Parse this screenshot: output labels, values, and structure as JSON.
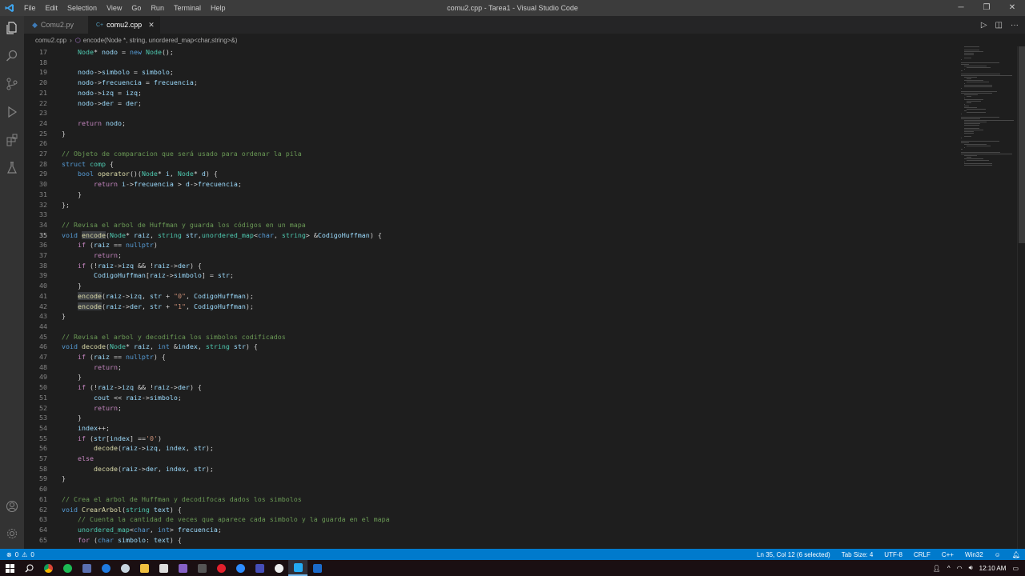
{
  "window": {
    "title": "comu2.cpp - Tarea1 - Visual Studio Code",
    "menu": [
      "File",
      "Edit",
      "Selection",
      "View",
      "Go",
      "Run",
      "Terminal",
      "Help"
    ]
  },
  "tabs": [
    {
      "label": "Comu2.py",
      "active": false
    },
    {
      "label": "comu2.cpp",
      "active": true
    }
  ],
  "breadcrumb": {
    "file": "comu2.cpp",
    "symbol": "encode(Node *, string, unordered_map<char,string>&)"
  },
  "editor": {
    "lines": [
      {
        "n": "17",
        "t": "    Node* nodo = new Node();"
      },
      {
        "n": "18",
        "t": ""
      },
      {
        "n": "19",
        "t": "    nodo->simbolo = simbolo;"
      },
      {
        "n": "20",
        "t": "    nodo->frecuencia = frecuencia;"
      },
      {
        "n": "21",
        "t": "    nodo->izq = izq;"
      },
      {
        "n": "22",
        "t": "    nodo->der = der;"
      },
      {
        "n": "23",
        "t": ""
      },
      {
        "n": "24",
        "t": "    return nodo;"
      },
      {
        "n": "25",
        "t": "}"
      },
      {
        "n": "26",
        "t": ""
      },
      {
        "n": "27",
        "t": "// Objeto de comparacion que será usado para ordenar la pila"
      },
      {
        "n": "28",
        "t": "struct comp {"
      },
      {
        "n": "29",
        "t": "    bool operator()(Node* i, Node* d) {"
      },
      {
        "n": "30",
        "t": "        return i->frecuencia > d->frecuencia;"
      },
      {
        "n": "31",
        "t": "    }"
      },
      {
        "n": "32",
        "t": "};"
      },
      {
        "n": "33",
        "t": ""
      },
      {
        "n": "34",
        "t": "// Revisa el arbol de Huffman y guarda los códigos en un mapa"
      },
      {
        "n": "35",
        "t": "void encode(Node* raiz, string str,unordered_map<char, string> &CodigoHuffman) {"
      },
      {
        "n": "36",
        "t": "    if (raiz == nullptr)"
      },
      {
        "n": "37",
        "t": "        return;"
      },
      {
        "n": "38",
        "t": "    if (!raiz->izq && !raiz->der) {"
      },
      {
        "n": "39",
        "t": "        CodigoHuffman[raiz->simbolo] = str;"
      },
      {
        "n": "40",
        "t": "    }"
      },
      {
        "n": "41",
        "t": "    encode(raiz->izq, str + \"0\", CodigoHuffman);"
      },
      {
        "n": "42",
        "t": "    encode(raiz->der, str + \"1\", CodigoHuffman);"
      },
      {
        "n": "43",
        "t": "}"
      },
      {
        "n": "44",
        "t": ""
      },
      {
        "n": "45",
        "t": "// Revisa el arbol y decodifica los simbolos codificados"
      },
      {
        "n": "46",
        "t": "void decode(Node* raiz, int &index, string str) {"
      },
      {
        "n": "47",
        "t": "    if (raiz == nullptr) {"
      },
      {
        "n": "48",
        "t": "        return;"
      },
      {
        "n": "49",
        "t": "    }"
      },
      {
        "n": "50",
        "t": "    if (!raiz->izq && !raiz->der) {"
      },
      {
        "n": "51",
        "t": "        cout << raiz->simbolo;"
      },
      {
        "n": "52",
        "t": "        return;"
      },
      {
        "n": "53",
        "t": "    }"
      },
      {
        "n": "54",
        "t": "    index++;"
      },
      {
        "n": "55",
        "t": "    if (str[index] =='0')"
      },
      {
        "n": "56",
        "t": "        decode(raiz->izq, index, str);"
      },
      {
        "n": "57",
        "t": "    else"
      },
      {
        "n": "58",
        "t": "        decode(raiz->der, index, str);"
      },
      {
        "n": "59",
        "t": "}"
      },
      {
        "n": "60",
        "t": ""
      },
      {
        "n": "61",
        "t": "// Crea el arbol de Huffman y decodifocas dados los simbolos"
      },
      {
        "n": "62",
        "t": "void CrearArbol(string text) {"
      },
      {
        "n": "63",
        "t": "    // Cuenta la cantidad de veces que aparece cada simbolo y la guarda en el mapa"
      },
      {
        "n": "64",
        "t": "    unordered_map<char, int> frecuencia;"
      },
      {
        "n": "65",
        "t": "    for (char simbolo: text) {"
      }
    ]
  },
  "status": {
    "errors": "0",
    "warnings": "0",
    "position": "Ln 35, Col 12 (6 selected)",
    "tabsize": "Tab Size: 4",
    "encoding": "UTF-8",
    "eol": "CRLF",
    "language": "C++",
    "platform": "Win32"
  },
  "taskbar": {
    "time": "12:10 AM"
  },
  "colors": {
    "accent": "#007acc",
    "keyword": "#569cd6",
    "type": "#4ec9b0",
    "function": "#dcdcaa",
    "variable": "#9cdcfe",
    "string": "#ce9178",
    "comment": "#6a9955"
  }
}
